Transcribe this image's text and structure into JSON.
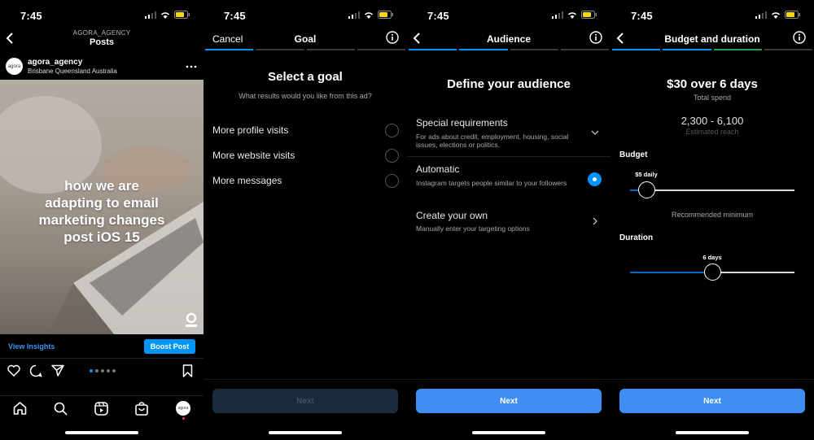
{
  "status_time": "7:45",
  "colors": {
    "accent": "#0095f6",
    "next_active": "#3f8ef5",
    "next_disabled": "#1a2b3e"
  },
  "post": {
    "header_overline": "AGORA_AGENCY",
    "header_title": "Posts",
    "avatar_text": "agora",
    "username": "agora_agency",
    "location": "Brisbane Queensland Australia",
    "image_text": [
      "how we are",
      "adapting to email",
      "marketing changes",
      "post iOS 15"
    ],
    "view_insights": "View Insights",
    "boost_post": "Boost Post",
    "bottom_avatar_text": "agora"
  },
  "goal": {
    "cancel": "Cancel",
    "title": "Goal",
    "heading": "Select a goal",
    "subheading": "What results would you like from this ad?",
    "options": [
      "More profile visits",
      "More website visits",
      "More messages"
    ],
    "next": "Next"
  },
  "audience": {
    "title": "Audience",
    "heading": "Define your audience",
    "options": [
      {
        "title": "Special requirements",
        "desc": "For ads about credit, employment, housing, social issues, elections or politics."
      },
      {
        "title": "Automatic",
        "desc": "Instagram targets people similar to your followers"
      },
      {
        "title": "Create your own",
        "desc": "Manually enter your targeting options"
      }
    ],
    "next": "Next"
  },
  "budget": {
    "title": "Budget and duration",
    "headline": "$30 over 6 days",
    "total_spend": "Total spend",
    "reach": "2,300 - 6,100",
    "reach_label": "Estimated reach",
    "budget_label": "Budget",
    "budget_value": "$5 daily",
    "budget_level": 0.1,
    "recommended": "Recommended minimum",
    "duration_label": "Duration",
    "duration_value": "6 days",
    "duration_level": 0.5,
    "next": "Next"
  }
}
